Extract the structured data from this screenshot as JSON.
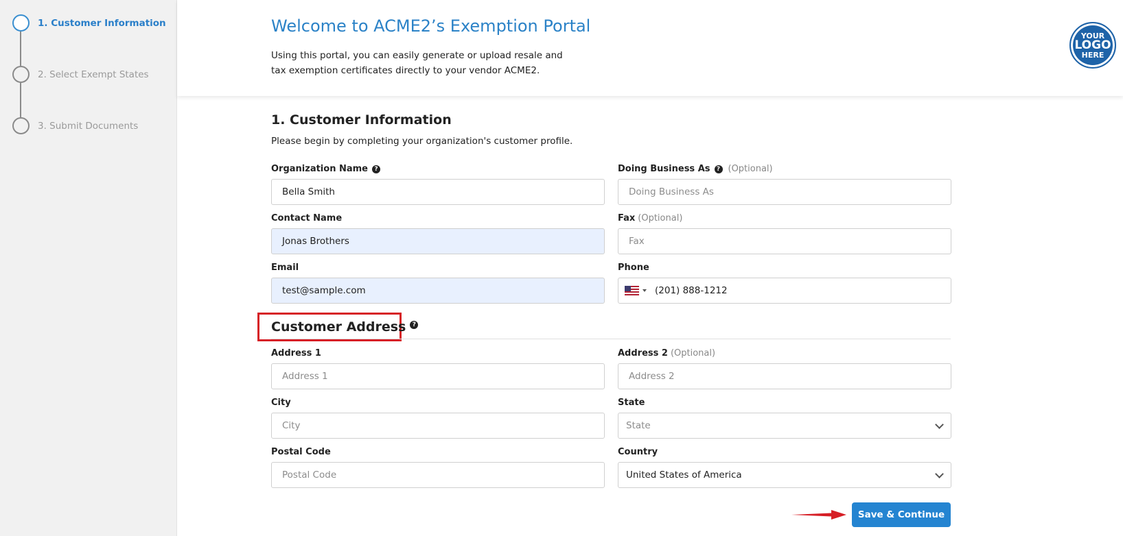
{
  "sidebar": {
    "steps": [
      {
        "label": "1. Customer Information",
        "active": true
      },
      {
        "label": "2. Select Exempt States",
        "active": false
      },
      {
        "label": "3. Submit Documents",
        "active": false
      }
    ]
  },
  "header": {
    "title": "Welcome to ACME2’s Exemption Portal",
    "intro": "Using this portal, you can easily generate or upload resale and tax exemption certificates directly to your vendor ACME2.",
    "logo": {
      "line1": "YOUR",
      "line2": "LOGO",
      "line3": "HERE"
    }
  },
  "section": {
    "title": "1. Customer Information",
    "subtitle": "Please begin by completing your organization's customer profile."
  },
  "fields": {
    "org_name": {
      "label": "Organization Name",
      "value": "Bella Smith"
    },
    "dba": {
      "label": "Doing Business As",
      "optional": "(Optional)",
      "placeholder": "Doing Business As"
    },
    "contact_name": {
      "label": "Contact Name",
      "value": "Jonas Brothers"
    },
    "fax": {
      "label": "Fax",
      "optional": "(Optional)",
      "placeholder": "Fax"
    },
    "email": {
      "label": "Email",
      "value": "test@sample.com"
    },
    "phone": {
      "label": "Phone",
      "value": "(201) 888-1212"
    }
  },
  "address": {
    "title": "Customer Address",
    "address1": {
      "label": "Address 1",
      "placeholder": "Address 1"
    },
    "address2": {
      "label": "Address 2",
      "optional": "(Optional)",
      "placeholder": "Address 2"
    },
    "city": {
      "label": "City",
      "placeholder": "City"
    },
    "state": {
      "label": "State",
      "placeholder": "State"
    },
    "postal": {
      "label": "Postal Code",
      "placeholder": "Postal Code"
    },
    "country": {
      "label": "Country",
      "value": "United States of America"
    }
  },
  "actions": {
    "save_label": "Save & Continue"
  },
  "colors": {
    "accent": "#2484d1",
    "highlight": "#d61f26"
  }
}
